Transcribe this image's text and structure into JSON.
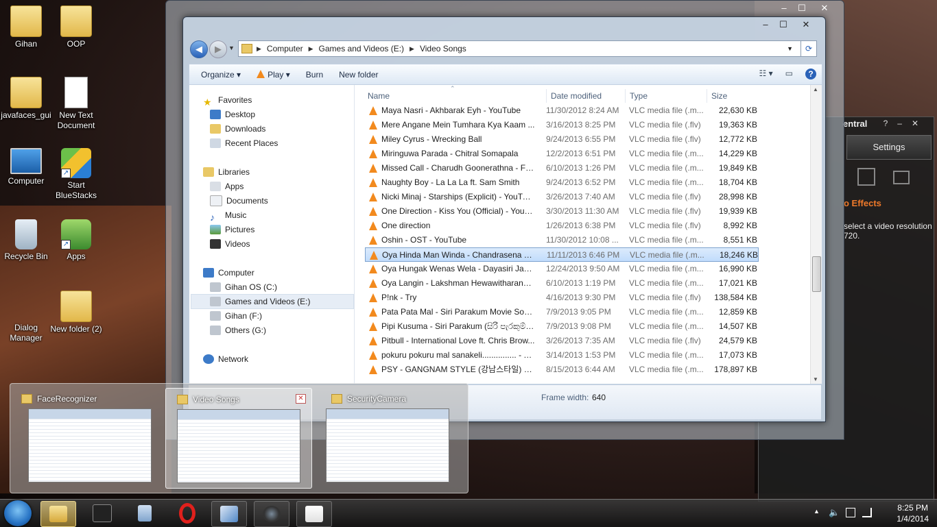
{
  "desktop": {
    "icons": [
      {
        "label": "Gihan"
      },
      {
        "label": "OOP"
      },
      {
        "label": "javafaces_gui"
      },
      {
        "label": "New Text Document"
      },
      {
        "label": "Computer"
      },
      {
        "label": "Start BlueStacks"
      },
      {
        "label": "Recycle Bin"
      },
      {
        "label": "Apps"
      },
      {
        "label": "Dialog Manager"
      },
      {
        "label": "New folder (2)"
      }
    ]
  },
  "media_panel": {
    "title_fragment": "entral",
    "settings_tab": "Settings",
    "effects_label": "o Effects",
    "hint": "select a video resolution",
    "hint2": "720."
  },
  "explorer": {
    "address": {
      "crumbs": [
        "Computer",
        "Games and Videos (E:)",
        "Video Songs"
      ]
    },
    "toolbar": {
      "organize": "Organize",
      "play": "Play",
      "burn": "Burn",
      "new_folder": "New folder"
    },
    "nav": {
      "favorites": "Favorites",
      "fav_items": [
        "Desktop",
        "Downloads",
        "Recent Places"
      ],
      "libraries": "Libraries",
      "lib_items": [
        "Apps",
        "Documents",
        "Music",
        "Pictures",
        "Videos"
      ],
      "computer": "Computer",
      "drives": [
        "Gihan OS (C:)",
        "Games and Videos (E:)",
        "Gihan (F:)",
        "Others (G:)"
      ],
      "network": "Network"
    },
    "columns": {
      "name": "Name",
      "date": "Date modified",
      "type": "Type",
      "size": "Size"
    },
    "files": [
      {
        "name": "Maya Nasri - Akhbarak Eyh - YouTube",
        "date": "11/30/2012 8:24 AM",
        "type": "VLC media file (.m...",
        "size": "22,630 KB"
      },
      {
        "name": "Mere Angane Mein Tumhara Kya Kaam ...",
        "date": "3/16/2013 8:25 PM",
        "type": "VLC media file (.flv)",
        "size": "19,363 KB"
      },
      {
        "name": "Miley Cyrus - Wrecking Ball",
        "date": "9/24/2013 6:55 PM",
        "type": "VLC media file (.flv)",
        "size": "12,772 KB"
      },
      {
        "name": "Miringuwa Parada - Chitral Somapala",
        "date": "12/2/2013 6:51 PM",
        "type": "VLC media file (.m...",
        "size": "14,229 KB"
      },
      {
        "name": "Missed Call - Charudh Goonerathna - Ful...",
        "date": "6/10/2013 1:26 PM",
        "type": "VLC media file (.m...",
        "size": "19,849 KB"
      },
      {
        "name": "Naughty Boy - La La La ft. Sam Smith",
        "date": "9/24/2013 6:52 PM",
        "type": "VLC media file (.m...",
        "size": "18,704 KB"
      },
      {
        "name": "Nicki Minaj - Starships (Explicit) - YouTube",
        "date": "3/26/2013 7:40 AM",
        "type": "VLC media file (.flv)",
        "size": "28,998 KB"
      },
      {
        "name": "One Direction - Kiss You (Official) - YouT...",
        "date": "3/30/2013 11:30 AM",
        "type": "VLC media file (.flv)",
        "size": "19,939 KB"
      },
      {
        "name": "One direction",
        "date": "1/26/2013 6:38 PM",
        "type": "VLC media file (.flv)",
        "size": "8,992 KB"
      },
      {
        "name": "Oshin - OST - YouTube",
        "date": "11/30/2012 10:08 ...",
        "type": "VLC media file (.m...",
        "size": "8,551 KB"
      },
      {
        "name": "Oya Hinda Man Winda - Chandrasena H...",
        "date": "11/11/2013 6:46 PM",
        "type": "VLC media file (.m...",
        "size": "18,246 KB"
      },
      {
        "name": "Oya Hungak Wenas Wela - Dayasiri Jayas...",
        "date": "12/24/2013 9:50 AM",
        "type": "VLC media file (.m...",
        "size": "16,990 KB"
      },
      {
        "name": "Oya Langin - Lakshman Hewawitharana-...",
        "date": "6/10/2013 1:19 PM",
        "type": "VLC media file (.m...",
        "size": "17,021 KB"
      },
      {
        "name": "P!nk - Try",
        "date": "4/16/2013 9:30 PM",
        "type": "VLC media file (.flv)",
        "size": "138,584 KB"
      },
      {
        "name": "Pata Pata Mal - Siri Parakum Movie Song...",
        "date": "7/9/2013 9:05 PM",
        "type": "VLC media file (.m...",
        "size": "12,859 KB"
      },
      {
        "name": "Pipi Kusuma - Siri Parakum (සිරි පැරකුම්) M...",
        "date": "7/9/2013 9:08 PM",
        "type": "VLC media file (.m...",
        "size": "14,507 KB"
      },
      {
        "name": "Pitbull - International Love ft. Chris Brow...",
        "date": "3/26/2013 7:35 AM",
        "type": "VLC media file (.flv)",
        "size": "24,579 KB"
      },
      {
        "name": "pokuru pokuru mal sanakeli............... - Yo...",
        "date": "3/14/2013 1:53 PM",
        "type": "VLC media file (.m...",
        "size": "17,073 KB"
      },
      {
        "name": "PSY - GANGNAM STYLE (강남스타일) MV",
        "date": "8/15/2013 6:44 AM",
        "type": "VLC media file (.m...",
        "size": "178,897 KB"
      }
    ],
    "selected_index": 10,
    "details": {
      "frame_width_label": "Frame width:",
      "frame_width_value": "640"
    }
  },
  "thumbnails": [
    {
      "title": "FaceRecognizer"
    },
    {
      "title": "Video Songs"
    },
    {
      "title": "SecurityCamera"
    }
  ],
  "taskbar": {
    "time": "8:25 PM",
    "date": "1/4/2014"
  }
}
